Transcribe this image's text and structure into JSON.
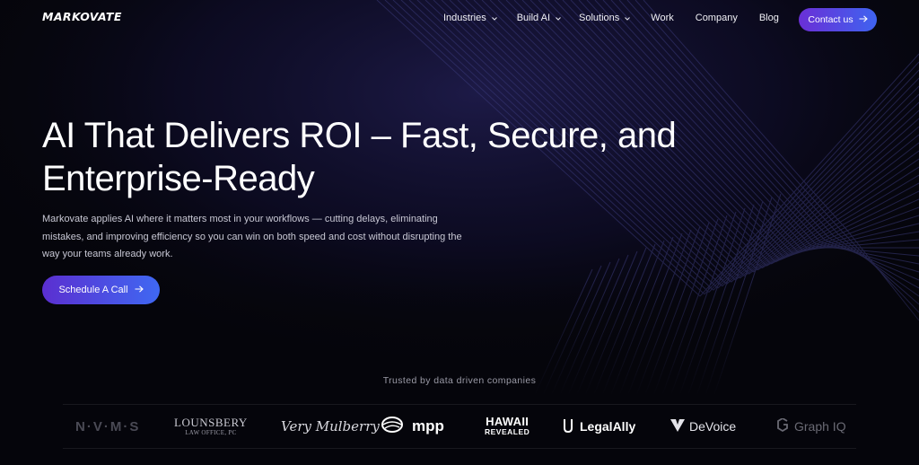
{
  "brand": {
    "name": "MARKOVATE"
  },
  "nav": {
    "items": [
      {
        "label": "Industries",
        "dropdown": true
      },
      {
        "label": "Build AI",
        "dropdown": true
      },
      {
        "label": "Solutions",
        "dropdown": true
      },
      {
        "label": "Work",
        "dropdown": false
      },
      {
        "label": "Company",
        "dropdown": false
      },
      {
        "label": "Blog",
        "dropdown": false
      }
    ],
    "contact_label": "Contact us"
  },
  "hero": {
    "title_line1": "AI That Delivers ROI – Fast, Secure, and",
    "title_line2": "Enterprise-Ready",
    "subtitle": "Markovate applies AI where it matters most in your workflows — cutting delays, eliminating mistakes, and improving efficiency so you can win on both speed and cost without disrupting the way your teams already work.",
    "cta_label": "Schedule A Call"
  },
  "trusted": {
    "heading": "Trusted by data driven companies",
    "logos": {
      "nvms": "N·V·M·S",
      "lounsbery_line1": "LOUNSBERY",
      "lounsbery_line2": "LAW OFFICE, PC",
      "mulberry": "Very Mulberry",
      "mpp": "mpp",
      "hawaii_line1": "HAWAII",
      "hawaii_line2": "REVEALED",
      "legalally": "LegalAlly",
      "devoice": "DeVoice",
      "graphiq": "Graph IQ"
    }
  },
  "colors": {
    "background": "#05050b",
    "accent_start": "#6a2fd6",
    "accent_end": "#3f63f0"
  },
  "icons": {
    "nav_dropdown": "chevron-down-icon",
    "button_arrow": "arrow-right-icon"
  }
}
